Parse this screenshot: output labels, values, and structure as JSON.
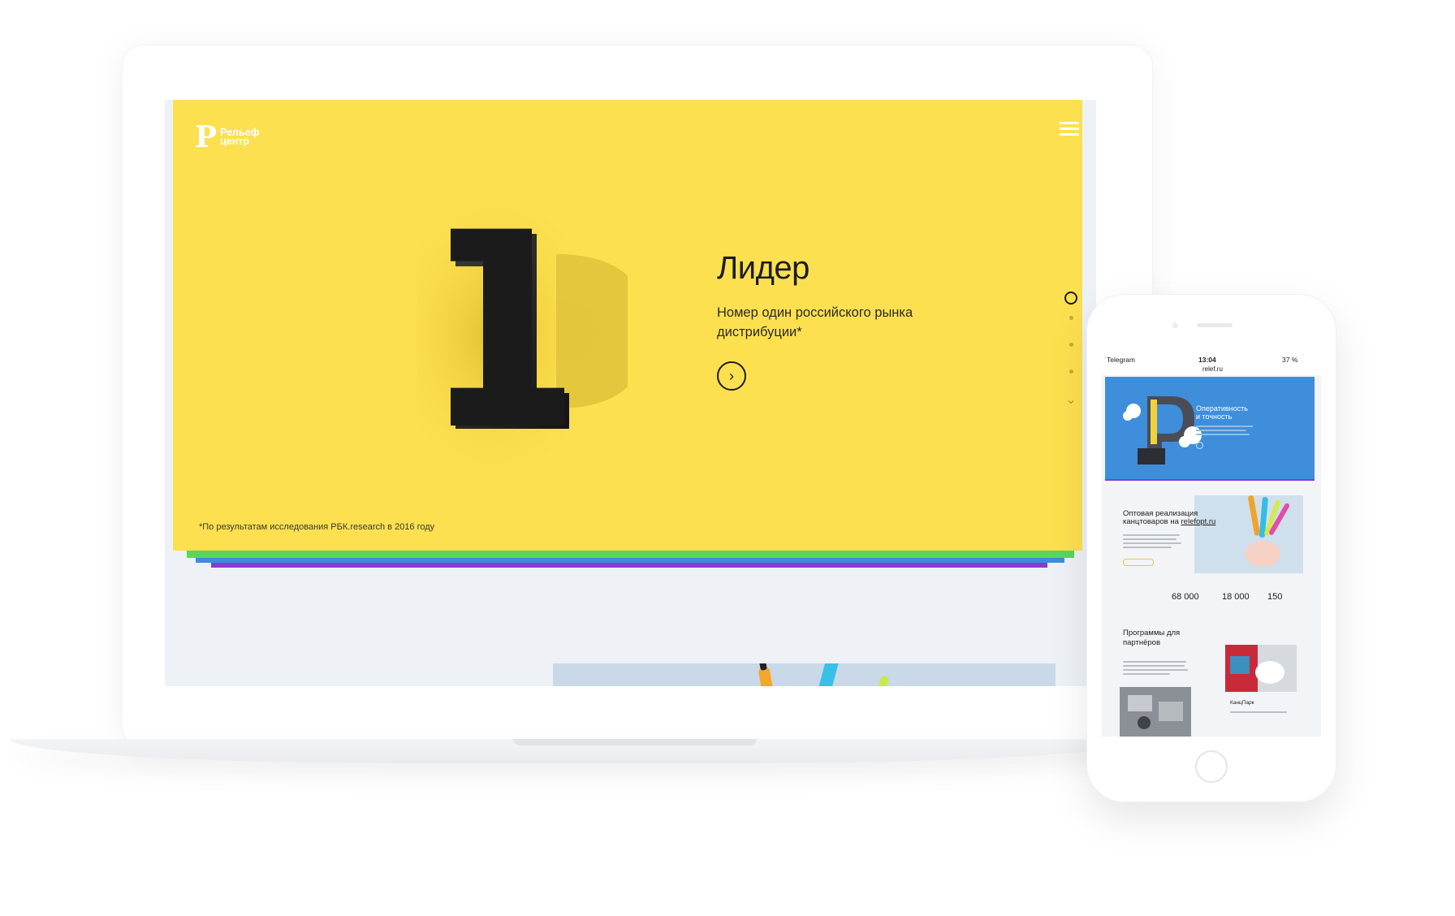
{
  "laptop_site": {
    "logo": {
      "mark": "P",
      "line1": "Рельеф",
      "line2": "центр"
    },
    "hero": {
      "title": "Лидер",
      "subtitle": "Номер один российского рынка дистрибуции*",
      "next_icon": "arrow-right-circle-icon",
      "footnote": "*По результатам исследования РБК.research в 2016 году",
      "background": "#fde04f"
    },
    "pager": {
      "count": 4,
      "active": 0,
      "down_icon": "chevron-down-icon"
    },
    "stripe_colors": [
      "#5bd65a",
      "#3f8bdc",
      "#8a3bd1"
    ]
  },
  "phone": {
    "status": {
      "app": "Telegram",
      "time": "13:04",
      "battery": "37 %",
      "url": "relef.ru"
    },
    "hero": {
      "title_line1": "Оперативность",
      "title_line2": "и точность",
      "background": "#3f8edb"
    },
    "wholesale": {
      "title_line1": "Оптовая реализация",
      "title_line2": "канцтоваров на",
      "link": "relefopt.ru",
      "stats": [
        "68 000",
        "18 000",
        "150"
      ]
    },
    "partners": {
      "title_line1": "Программы для",
      "title_line2": "партнёров",
      "caption": "КанцПарк"
    }
  }
}
